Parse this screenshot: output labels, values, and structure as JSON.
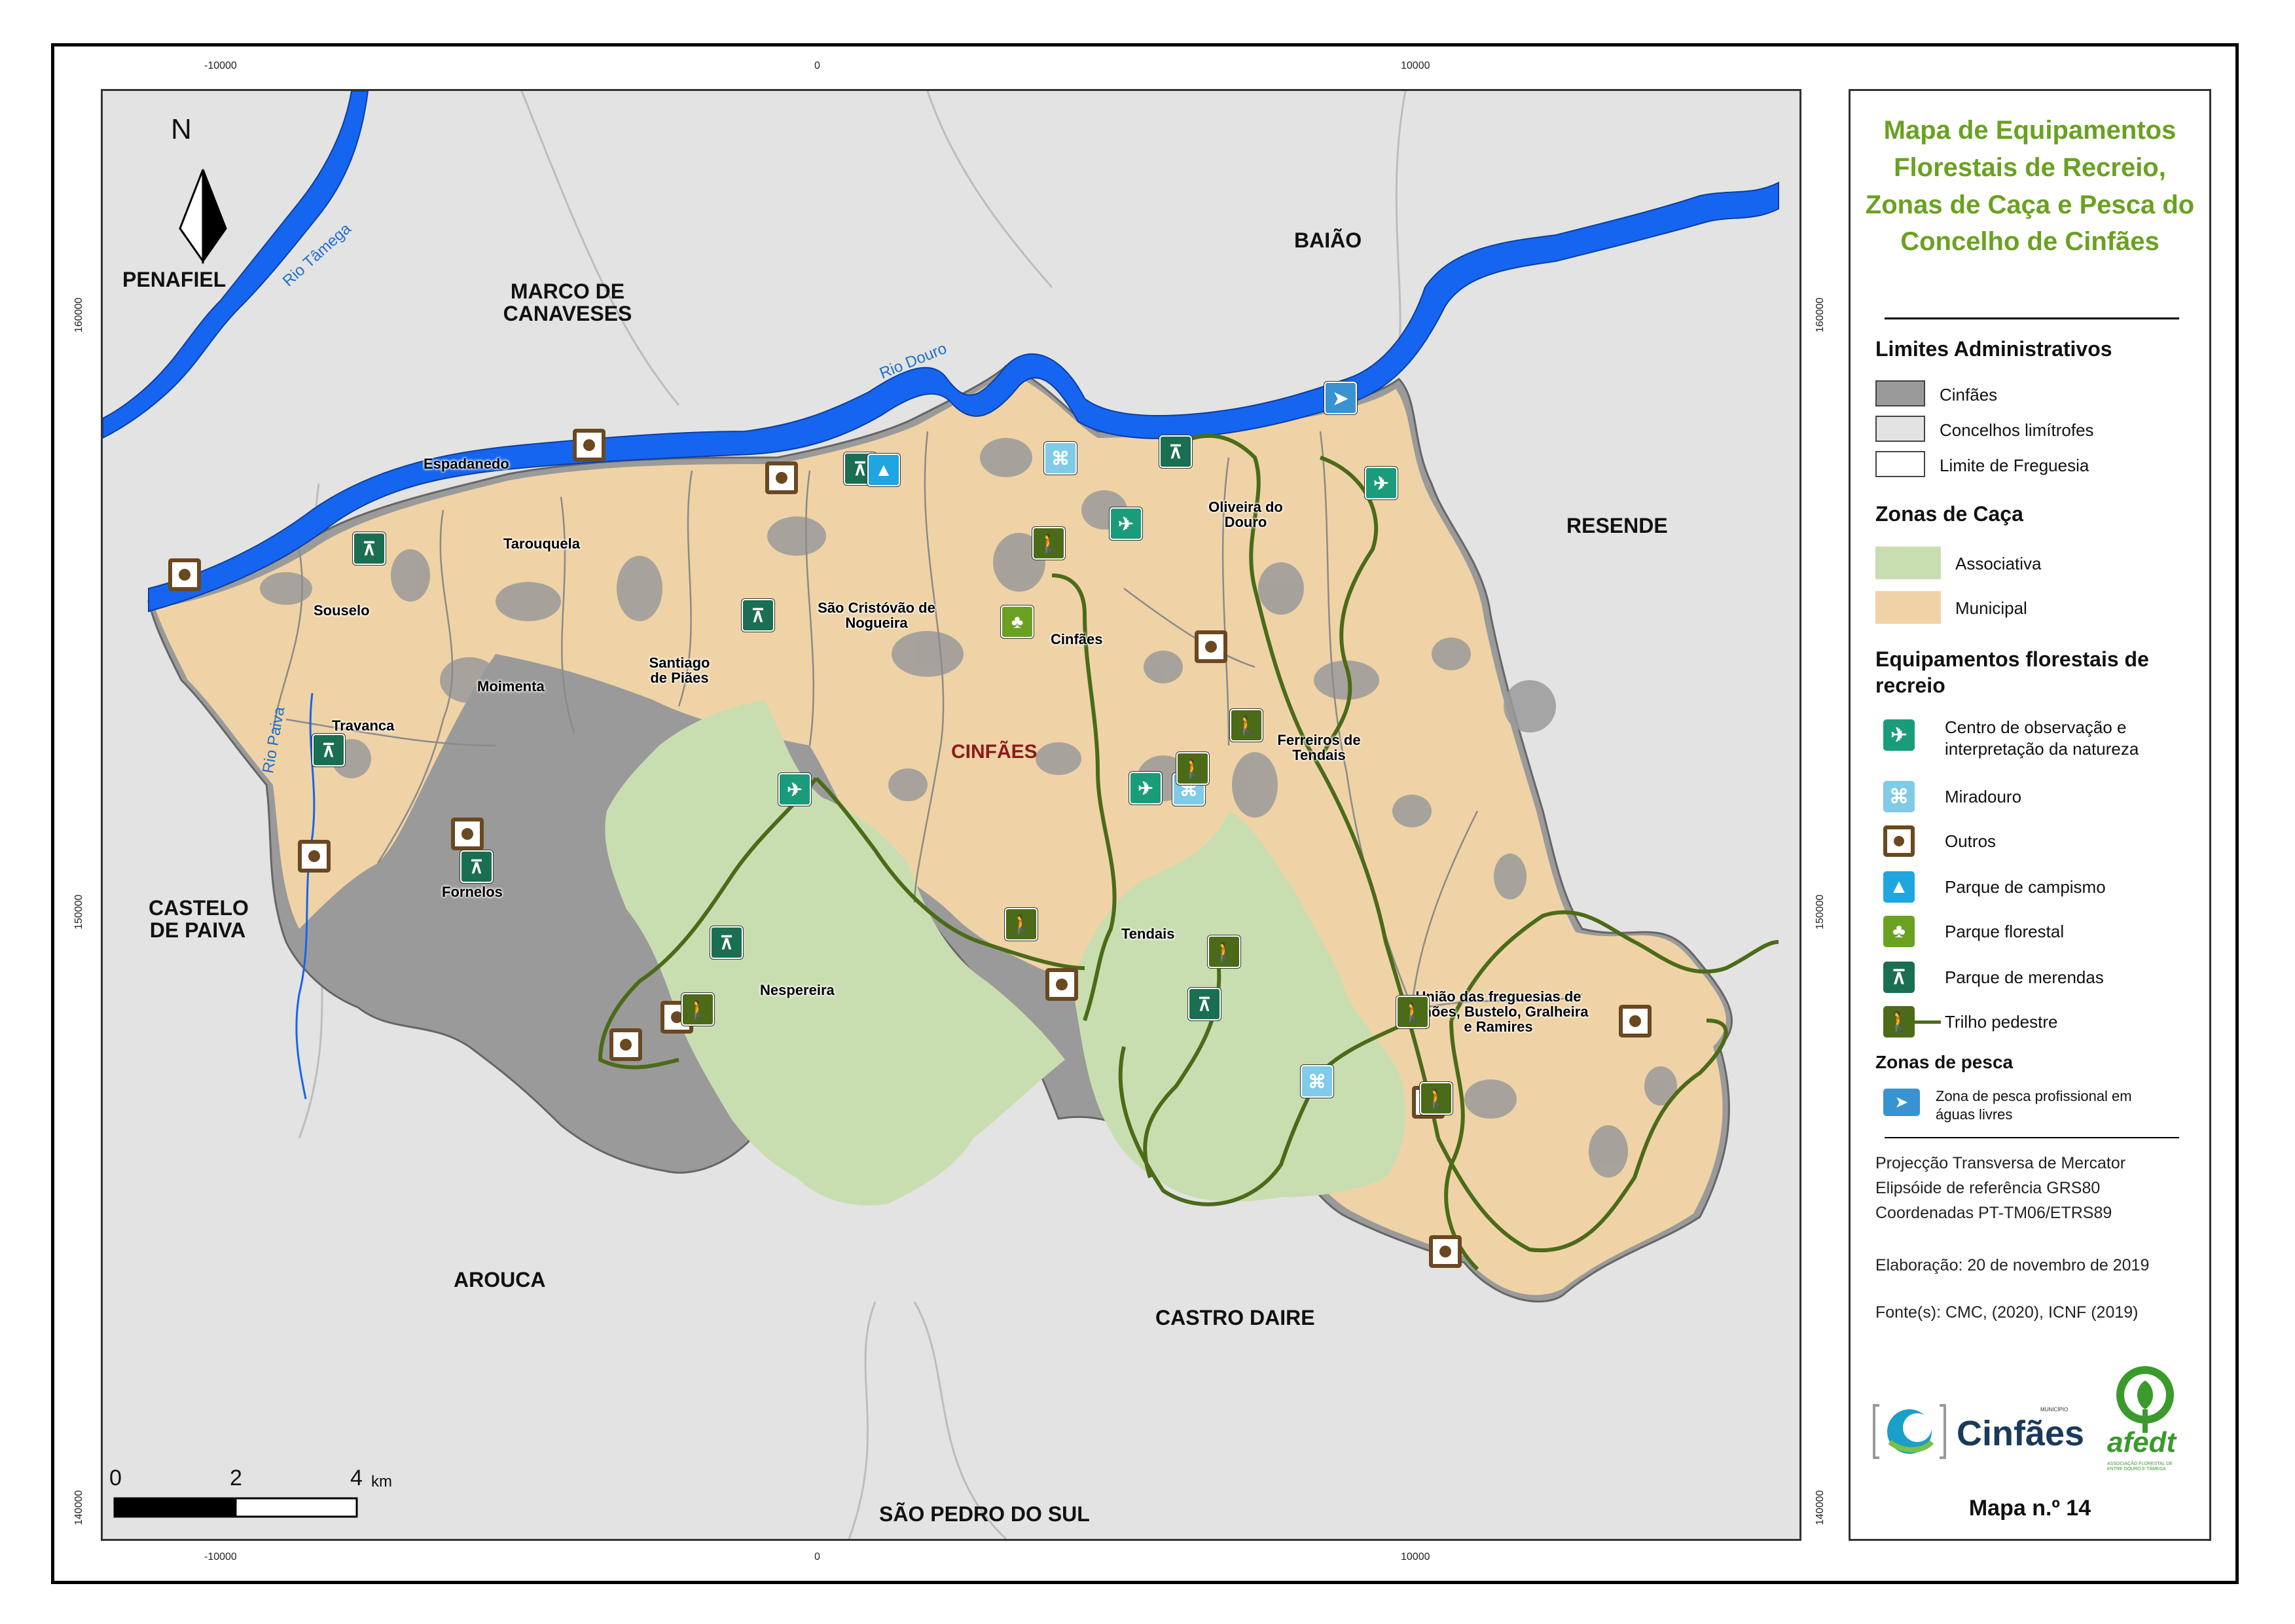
{
  "title": "Mapa de Equipamentos Florestais de Recreio, Zonas de Caça e Pesca do Concelho de Cinfães",
  "colors": {
    "cinfaes": "#9a9a9a",
    "limitrofes": "#e3e3e3",
    "associativa": "#c9deb0",
    "municipal": "#efd3a6",
    "water": "#1565f0",
    "trail": "#5a7a1e",
    "title_green": "#6aa121"
  },
  "axis": {
    "x_ticks": [
      "-10000",
      "0",
      "10000"
    ],
    "y_ticks": [
      "160000",
      "150000",
      "140000"
    ]
  },
  "map_labels": {
    "north": "N",
    "regions": [
      "PENAFIEL",
      "MARCO DE CANAVESES",
      "BAIÃO",
      "RESENDE",
      "CASTELO DE PAIVA",
      "AROUCA",
      "CASTRO DAIRE",
      "SÃO PEDRO DO SUL"
    ],
    "rivers": [
      "Rio Tâmega",
      "Rio Douro",
      "Rio Paiva"
    ],
    "capital": "CINFÃES",
    "parishes": [
      "Espadanedo",
      "Tarouquela",
      "Souselo",
      "Moimenta",
      "Travanca",
      "Santiago de Piães",
      "São Cristóvão de Nogueira",
      "Cinfães",
      "Oliveira do Douro",
      "Ferreiros de Tendais",
      "Fornelos",
      "Nespereira",
      "Tendais",
      "União das freguesias de Alhões, Bustelo, Gralheira e Ramires"
    ]
  },
  "scalebar": {
    "labels": [
      "0",
      "2",
      "4"
    ],
    "unit": "km"
  },
  "legend": {
    "section_admin": "Limites Administrativos",
    "admin_items": [
      "Cinfães",
      "Concelhos limítrofes",
      "Limite de Freguesia"
    ],
    "section_caca": "Zonas de Caça",
    "caca_items": [
      "Associativa",
      "Municipal"
    ],
    "section_equip": "Equipamentos florestais de recreio",
    "equip_items": [
      {
        "label": "Centro de observação e interpretação da natureza",
        "icon": "bird-icon"
      },
      {
        "label": "Miradouro",
        "icon": "binoculars-icon"
      },
      {
        "label": "Outros",
        "icon": "dot-square-icon"
      },
      {
        "label": "Parque de campismo",
        "icon": "tent-icon"
      },
      {
        "label": "Parque florestal",
        "icon": "tree-icon"
      },
      {
        "label": "Parque de merendas",
        "icon": "picnic-table-icon"
      },
      {
        "label": "Trilho pedestre",
        "icon": "hiker-icon"
      }
    ],
    "section_pesca": "Zonas de pesca",
    "pesca_items": [
      "Zona de pesca profissional em águas livres"
    ]
  },
  "info": {
    "projection": "Projecção Transversa de Mercator",
    "ellipsoid": "Elipsóide de referência GRS80",
    "coords": "Coordenadas PT-TM06/ETRS89",
    "date": "Elaboração: 20 de novembro de 2019",
    "sources": "Fonte(s): CMC, (2020), ICNF (2019)"
  },
  "logos": {
    "cinfaes": "Cinfães",
    "cinfaes_small": "MUNICÍPIO",
    "afedt": "afedt",
    "afedt_small": "ASSOCIAÇÃO FLORESTAL DE ENTRE DOURO E TÂMEGA"
  },
  "map_number": "Mapa n.º 14"
}
